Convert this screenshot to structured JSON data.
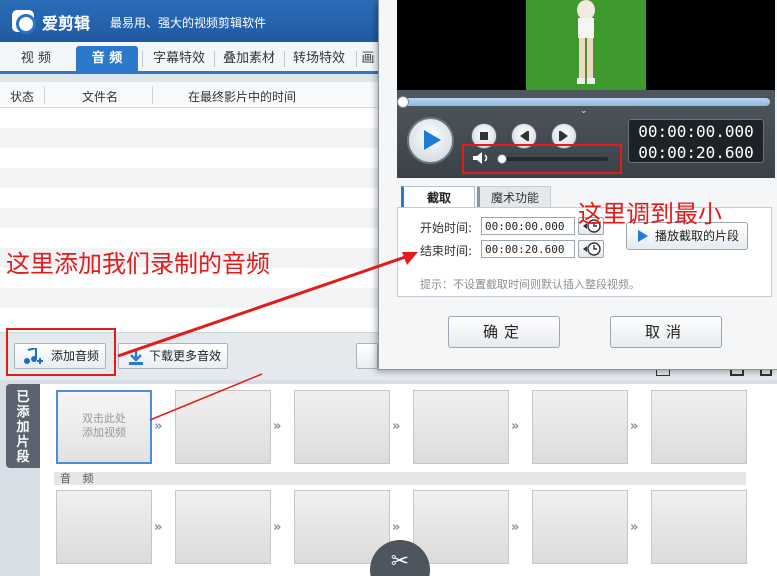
{
  "app": {
    "name": "爱剪辑",
    "slogan": "最易用、强大的视频剪辑软件"
  },
  "tabs": [
    {
      "label": "视  频"
    },
    {
      "label": "音  频"
    },
    {
      "label": "字幕特效"
    },
    {
      "label": "叠加素材"
    },
    {
      "label": "转场特效"
    },
    {
      "label": "画"
    }
  ],
  "list": {
    "columns": [
      "状态",
      "文件名",
      "在最终影片中的时间"
    ]
  },
  "toolbar": {
    "add_audio": "添加音频",
    "download_more": "下载更多音效"
  },
  "clips": {
    "side_tab": "已添加片段",
    "placeholder": "双击此处\n添加视频",
    "audio_label": "音  频"
  },
  "dialog": {
    "time_current": "00:00:00.000",
    "time_total": "00:00:20.600",
    "seek_progress": 0.0,
    "volume_level": 0.0,
    "tabs": [
      "截取",
      "魔术功能"
    ],
    "start_label": "开始时间:",
    "start_value": "00:00:00.000",
    "end_label": "结束时间:",
    "end_value": "00:00:20.600",
    "play_clip": "播放截取的片段",
    "hint": "提示：不设置截取时间则默认插入整段视频。",
    "confirm": "确定",
    "cancel": "取消"
  },
  "annotations": {
    "add_audio_note": "这里添加我们录制的音频",
    "volume_note": "这里调到最小"
  },
  "colors": {
    "title_blue": "#2b6db8",
    "tab_active": "#2c79cc",
    "annotation_red": "#e21b1b",
    "video_green": "#3f9a2e"
  }
}
